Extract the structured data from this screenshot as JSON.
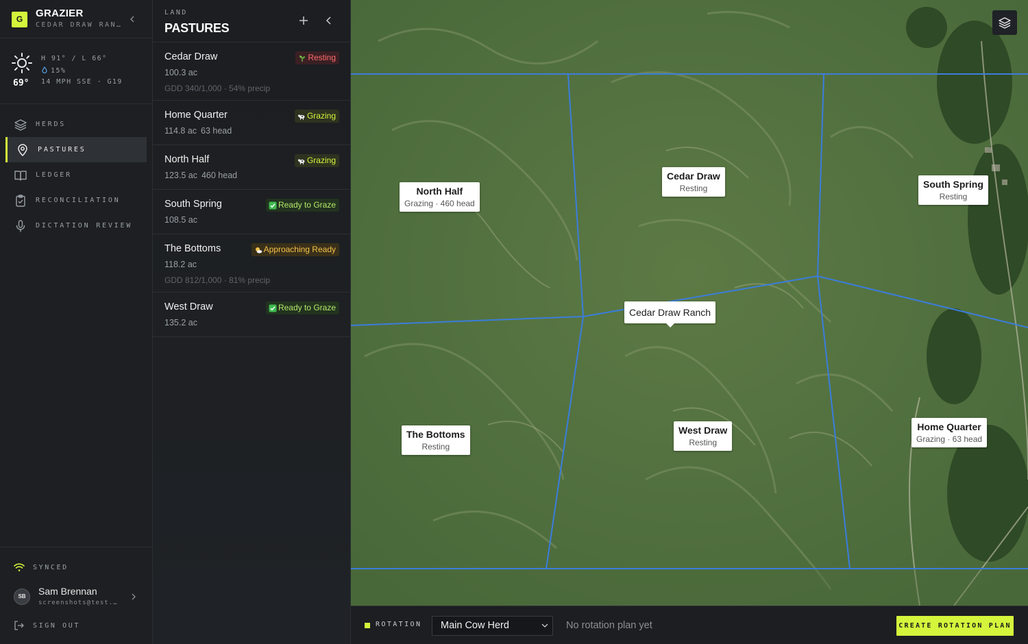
{
  "brand": {
    "logo": "G",
    "name": "GRAZIER",
    "ranch": "CEDAR DRAW RANCH"
  },
  "weather": {
    "icon": "sun-icon",
    "temp": "69°",
    "hilo": "H 91° / L 66°",
    "precip": "15%",
    "wind": "14 MPH SSE · G19"
  },
  "nav": [
    {
      "label": "HERDS",
      "icon": "layers-icon"
    },
    {
      "label": "PASTURES",
      "icon": "map-pin-icon",
      "active": true
    },
    {
      "label": "LEDGER",
      "icon": "book-icon"
    },
    {
      "label": "RECONCILIATION",
      "icon": "clipboard-check-icon"
    },
    {
      "label": "DICTATION REVIEW",
      "icon": "microphone-icon"
    }
  ],
  "footer": {
    "sync": "SYNCED",
    "user": {
      "initials": "SB",
      "name": "Sam Brennan",
      "email": "screenshots@test.dev"
    },
    "signout": "SIGN OUT"
  },
  "panel": {
    "kicker": "LAND",
    "title": "PASTURES",
    "pastures": [
      {
        "name": "Cedar Draw",
        "acres": "100.3 ac",
        "head": "",
        "gdd": "GDD 340/1,000 · 54% precip",
        "status": "Resting",
        "status_type": "resting",
        "status_icon": "sprout-icon"
      },
      {
        "name": "Home Quarter",
        "acres": "114.8 ac",
        "head": "63 head",
        "gdd": "",
        "status": "Grazing",
        "status_type": "grazing",
        "status_icon": "cow-icon"
      },
      {
        "name": "North Half",
        "acres": "123.5 ac",
        "head": "460 head",
        "gdd": "",
        "status": "Grazing",
        "status_type": "grazing",
        "status_icon": "cow-icon"
      },
      {
        "name": "South Spring",
        "acres": "108.5 ac",
        "head": "",
        "gdd": "",
        "status": "Ready to Graze",
        "status_type": "ready",
        "status_icon": "check-box-icon"
      },
      {
        "name": "The Bottoms",
        "acres": "118.2 ac",
        "head": "",
        "gdd": "GDD 812/1,000 · 81% precip",
        "status": "Approaching Ready",
        "status_type": "approach",
        "status_icon": "sun-cloud-icon"
      },
      {
        "name": "West Draw",
        "acres": "135.2 ac",
        "head": "",
        "gdd": "",
        "status": "Ready to Graze",
        "status_type": "ready",
        "status_icon": "check-box-icon"
      }
    ]
  },
  "map": {
    "ranch_label": "Cedar Draw Ranch",
    "labels": [
      {
        "name": "North Half",
        "sub": "Grazing · 460 head"
      },
      {
        "name": "Cedar Draw",
        "sub": "Resting"
      },
      {
        "name": "South Spring",
        "sub": "Resting"
      },
      {
        "name": "The Bottoms",
        "sub": "Resting"
      },
      {
        "name": "West Draw",
        "sub": "Resting"
      },
      {
        "name": "Home Quarter",
        "sub": "Grazing · 63 head"
      }
    ],
    "boundary_color": "#3b7ddd"
  },
  "bottombar": {
    "rotation_label": "ROTATION",
    "herd": "Main Cow Herd",
    "plan_status": "No rotation plan yet",
    "create_label": "CREATE ROTATION PLAN"
  },
  "colors": {
    "accent": "#d4f53c",
    "resting": "#ff6b6b",
    "approach": "#f5c24a"
  }
}
